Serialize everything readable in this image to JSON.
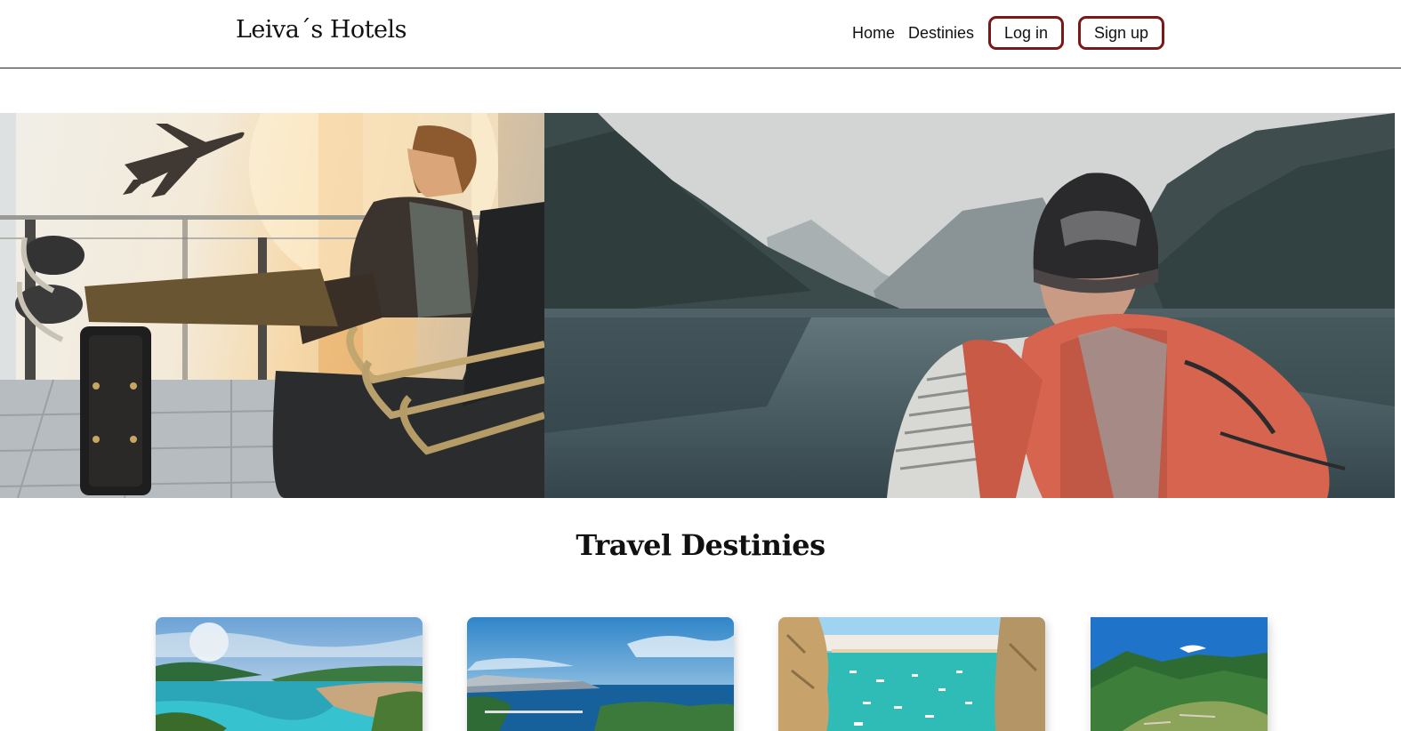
{
  "header": {
    "brand": "Leiva´s Hotels",
    "nav": {
      "home": "Home",
      "destinies": "Destinies",
      "login": "Log in",
      "signup": "Sign up"
    },
    "accent_color": "#7a1717"
  },
  "hero": {
    "left_image": "traveler-airport-photo",
    "right_image": "backpacker-lake-photo"
  },
  "destinations": {
    "title": "Travel Destinies",
    "cards": [
      {
        "image": "mediterranean-bay-photo"
      },
      {
        "image": "coastal-harbor-photo"
      },
      {
        "image": "cliff-beach-boats-photo"
      },
      {
        "image": "mountain-valley-photo"
      }
    ]
  }
}
